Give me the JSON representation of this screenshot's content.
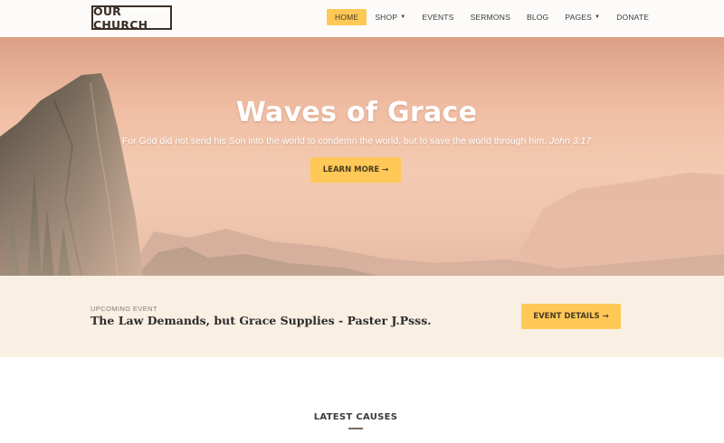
{
  "brand": {
    "logo_text": "OUR CHURCH"
  },
  "nav": {
    "items": [
      {
        "label": "HOME",
        "active": true,
        "has_dropdown": false
      },
      {
        "label": "SHOP",
        "active": false,
        "has_dropdown": true
      },
      {
        "label": "EVENTS",
        "active": false,
        "has_dropdown": false
      },
      {
        "label": "SERMONS",
        "active": false,
        "has_dropdown": false
      },
      {
        "label": "BLOG",
        "active": false,
        "has_dropdown": false
      },
      {
        "label": "PAGES",
        "active": false,
        "has_dropdown": true
      },
      {
        "label": "DONATE",
        "active": false,
        "has_dropdown": false
      }
    ],
    "dropdown_icon": "caret-down-icon"
  },
  "hero": {
    "title": "Waves of Grace",
    "verse_text": "For God did not send his Son into the world to condemn the world, but to save the world through him.",
    "verse_ref": "John 3:17",
    "button_label": "LEARN MORE →"
  },
  "event": {
    "kicker": "UPCOMING EVENT",
    "title": "The Law Demands, but Grace Supplies - Paster J.Psss.",
    "button_label": "EVENT DETAILS →"
  },
  "sections": {
    "latest_causes_heading": "LATEST CAUSES"
  },
  "colors": {
    "accent": "#ffc857",
    "logo_border": "#3b2f27",
    "event_bg": "#f9efe3"
  }
}
